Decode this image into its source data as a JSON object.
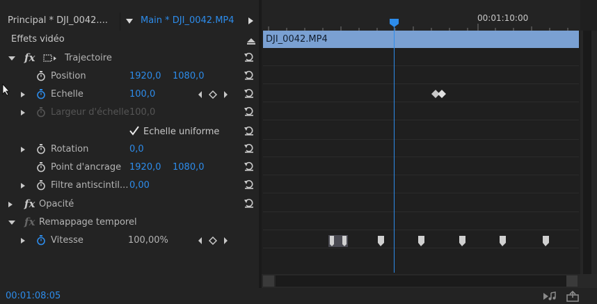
{
  "tabs": {
    "inactive_label": "Principal * DJI_0042....",
    "active_label": "Main * DJI_0042.MP4"
  },
  "section": {
    "title": "Effets vidéo"
  },
  "effects": {
    "trajectoire": {
      "label": "Trajectoire"
    },
    "position": {
      "label": "Position",
      "x": "1920,0",
      "y": "1080,0"
    },
    "echelle": {
      "label": "Echelle",
      "value": "100,0"
    },
    "largeur": {
      "label": "Largeur d'échelle",
      "value": "100,0"
    },
    "uniforme": {
      "label": "Echelle uniforme",
      "checked": true
    },
    "rotation": {
      "label": "Rotation",
      "value": "0,0"
    },
    "ancrage": {
      "label": "Point d'ancrage",
      "x": "1920,0",
      "y": "1080,0"
    },
    "antiscint": {
      "label": "Filtre antiscintil...",
      "value": "0,00"
    },
    "opacite": {
      "label": "Opacité"
    },
    "remappage": {
      "label": "Remappage temporel"
    },
    "vitesse": {
      "label": "Vitesse",
      "value": "100,00%"
    }
  },
  "timeline": {
    "ruler_timecode": "00:01:10:00",
    "clip_name": "DJI_0042.MP4"
  },
  "status": {
    "current_timecode": "00:01:08:05"
  },
  "colors": {
    "accent": "#2d8ceb",
    "clip": "#7aa0d2",
    "background": "#232323"
  },
  "icons": [
    "stopwatch-icon",
    "reset-icon",
    "keyframe-nav-icon",
    "fx-icon",
    "transform-icon",
    "checkbox-icon",
    "play-audio-icon",
    "export-icon"
  ]
}
